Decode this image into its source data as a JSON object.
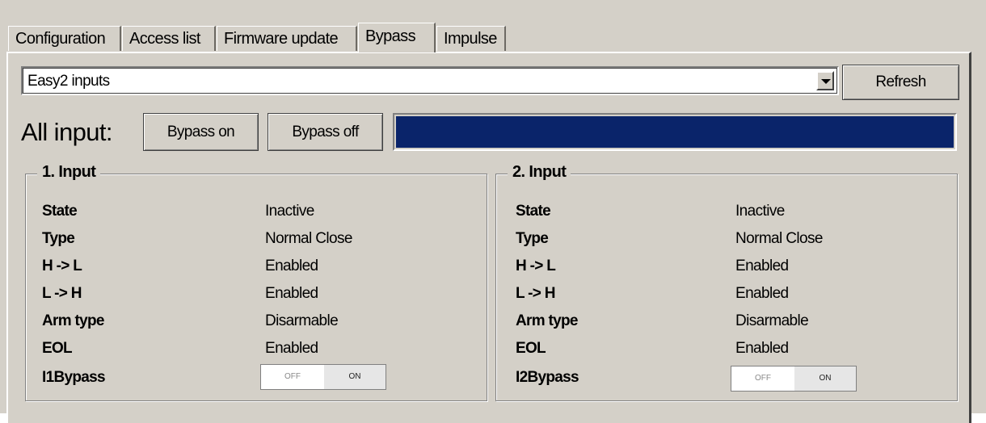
{
  "tabs": [
    {
      "label": "Configuration",
      "active": false
    },
    {
      "label": "Access list",
      "active": false
    },
    {
      "label": "Firmware update",
      "active": false
    },
    {
      "label": "Bypass",
      "active": true
    },
    {
      "label": "Impulse",
      "active": false
    }
  ],
  "device_select": {
    "value": "Easy2 inputs"
  },
  "refresh_label": "Refresh",
  "all_input": {
    "label": "All input:",
    "bypass_on_label": "Bypass on",
    "bypass_off_label": "Bypass off",
    "progress": 1.0
  },
  "inputs": [
    {
      "title": "1. Input",
      "rows": [
        {
          "label": "State",
          "value": "Inactive"
        },
        {
          "label": "Type",
          "value": "Normal Close"
        },
        {
          "label": "H -> L",
          "value": "Enabled"
        },
        {
          "label": "L -> H",
          "value": "Enabled"
        },
        {
          "label": "Arm type",
          "value": "Disarmable"
        },
        {
          "label": "EOL",
          "value": "Enabled"
        }
      ],
      "bypass_label": "I1Bypass",
      "toggle": {
        "off": "OFF",
        "on": "ON",
        "state": "off"
      }
    },
    {
      "title": "2. Input",
      "rows": [
        {
          "label": "State",
          "value": "Inactive"
        },
        {
          "label": "Type",
          "value": "Normal Close"
        },
        {
          "label": "H -> L",
          "value": "Enabled"
        },
        {
          "label": "L -> H",
          "value": "Enabled"
        },
        {
          "label": "Arm type",
          "value": "Disarmable"
        },
        {
          "label": "EOL",
          "value": "Enabled"
        }
      ],
      "bypass_label": "I2Bypass",
      "toggle": {
        "off": "OFF",
        "on": "ON",
        "state": "off"
      }
    }
  ],
  "colors": {
    "progress_fill": "#0a246a",
    "background": "#d4d0c8"
  }
}
